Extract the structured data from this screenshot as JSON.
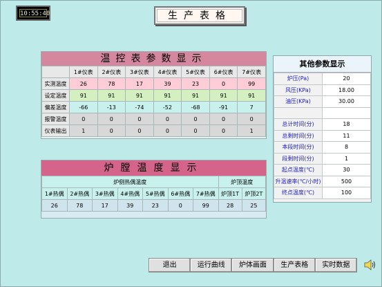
{
  "clock": "10:55:40",
  "title": "生产表格",
  "meter_panel": {
    "banner": "温控表参数显示",
    "columns": [
      "1#仪表",
      "2#仪表",
      "3#仪表",
      "4#仪表",
      "5#仪表",
      "6#仪表",
      "7#仪表"
    ],
    "rows": [
      {
        "label": "实测温度",
        "values": [
          "26",
          "78",
          "17",
          "39",
          "23",
          "0",
          "99"
        ]
      },
      {
        "label": "设定温度",
        "values": [
          "91",
          "91",
          "91",
          "91",
          "91",
          "91",
          "91"
        ]
      },
      {
        "label": "偏差温度",
        "values": [
          "-66",
          "-13",
          "-74",
          "-52",
          "-68",
          "-91",
          "7"
        ]
      },
      {
        "label": "报警温度",
        "values": [
          "0",
          "0",
          "0",
          "0",
          "0",
          "0",
          "0"
        ]
      },
      {
        "label": "仪表输出",
        "values": [
          "1",
          "0",
          "0",
          "0",
          "0",
          "0",
          "1"
        ]
      }
    ]
  },
  "furnace_panel": {
    "banner": "炉膛温度显示",
    "group_side": "炉侧热偶温度",
    "group_top": "炉顶温度",
    "columns": [
      "1#热偶",
      "2#热偶",
      "3#热偶",
      "4#热偶",
      "5#热偶",
      "6#热偶",
      "7#热偶",
      "炉顶1T",
      "炉顶2T"
    ],
    "values": [
      "26",
      "78",
      "17",
      "39",
      "23",
      "0",
      "99",
      "28",
      "25"
    ]
  },
  "other_panel": {
    "title": "其他参数显示",
    "rows": [
      {
        "label": "炉压(Pa)",
        "value": "20"
      },
      {
        "label": "风压(KPa)",
        "value": "18.00"
      },
      {
        "label": "油压(KPa)",
        "value": "30.00"
      },
      {
        "label": "",
        "value": ""
      },
      {
        "label": "总计时间(分)",
        "value": "18"
      },
      {
        "label": "总剩时间(分)",
        "value": "11"
      },
      {
        "label": "本段时间(分)",
        "value": "8"
      },
      {
        "label": "段剩时间(分)",
        "value": "1"
      },
      {
        "label": "起点温度(℃)",
        "value": "30"
      },
      {
        "label": "升温速率(℃/小时)",
        "value": "500"
      },
      {
        "label": "终点温度(℃)",
        "value": "100"
      }
    ]
  },
  "toolbar": {
    "exit": "退出",
    "curve": "运行曲线",
    "furnace": "炉体画面",
    "table": "生产表格",
    "realtime": "实时数据"
  },
  "icons": {
    "speaker": "speaker-icon"
  }
}
